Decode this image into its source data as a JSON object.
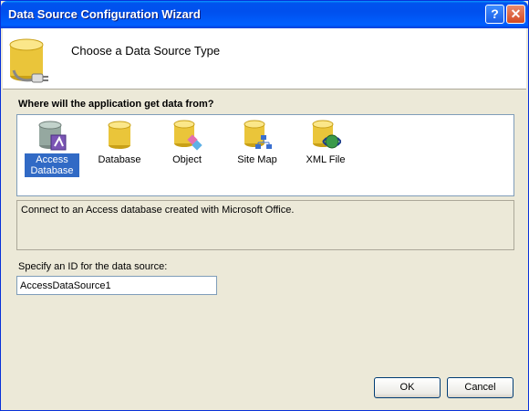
{
  "window": {
    "title": "Data Source Configuration Wizard"
  },
  "titlebar_buttons": {
    "help": "?",
    "close": "✕"
  },
  "header": {
    "title": "Choose a Data Source Type"
  },
  "question": "Where will the application get data from?",
  "types": [
    {
      "label": "Access Database",
      "icon": "access-database-icon",
      "selected": true
    },
    {
      "label": "Database",
      "icon": "database-icon",
      "selected": false
    },
    {
      "label": "Object",
      "icon": "object-icon",
      "selected": false
    },
    {
      "label": "Site Map",
      "icon": "site-map-icon",
      "selected": false
    },
    {
      "label": "XML File",
      "icon": "xml-file-icon",
      "selected": false
    }
  ],
  "description": "Connect to an Access database created with Microsoft Office.",
  "id_field": {
    "label": "Specify an ID for the data source:",
    "value": "AccessDataSource1"
  },
  "buttons": {
    "ok": "OK",
    "cancel": "Cancel"
  },
  "colors": {
    "titlebar": "#0054e3",
    "selection": "#316ac5",
    "dialog_bg": "#ece9d8",
    "cylinder_gold": "#e8b820"
  }
}
